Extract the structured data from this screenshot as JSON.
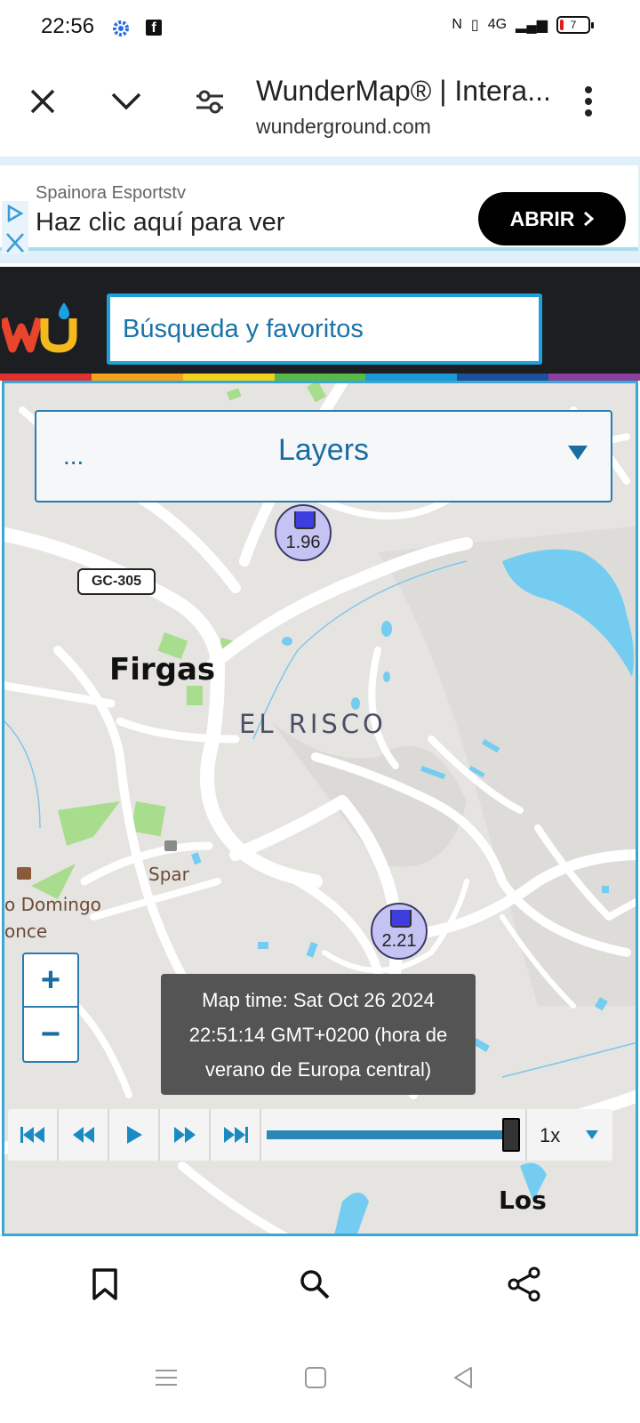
{
  "status": {
    "time": "22:56",
    "network": "4G",
    "battery": "7"
  },
  "browser": {
    "title": "WunderMap® | Intera...",
    "url": "wunderground.com"
  },
  "ad": {
    "advertiser": "Spainora Esportstv",
    "headline": "Haz clic aquí para ver",
    "cta": "ABRIR"
  },
  "header": {
    "search_placeholder": "Búsqueda y favoritos"
  },
  "colors": {
    "rainbow": [
      "#e0312e",
      "#f2a31b",
      "#f1d21a",
      "#58b848",
      "#1b98d5",
      "#1e4e9c",
      "#8b3f9e"
    ]
  },
  "map": {
    "layers": {
      "dots": "...",
      "label": "Layers"
    },
    "stations": [
      {
        "value": "1.96"
      },
      {
        "value": "2.21"
      }
    ],
    "road": "GC-305",
    "places": {
      "firgas": "Firgas",
      "risco": "EL RISCO",
      "spar": "Spar",
      "domingo": "o Domingo",
      "once": "once",
      "los": "Los"
    },
    "zoom": {
      "in": "+",
      "out": "−"
    },
    "map_time": [
      "Map time: Sat Oct 26 2024",
      "22:51:14 GMT+0200 (hora de",
      "verano de Europa central)"
    ],
    "player": {
      "speed": "1x",
      "progress": 1.0
    }
  }
}
